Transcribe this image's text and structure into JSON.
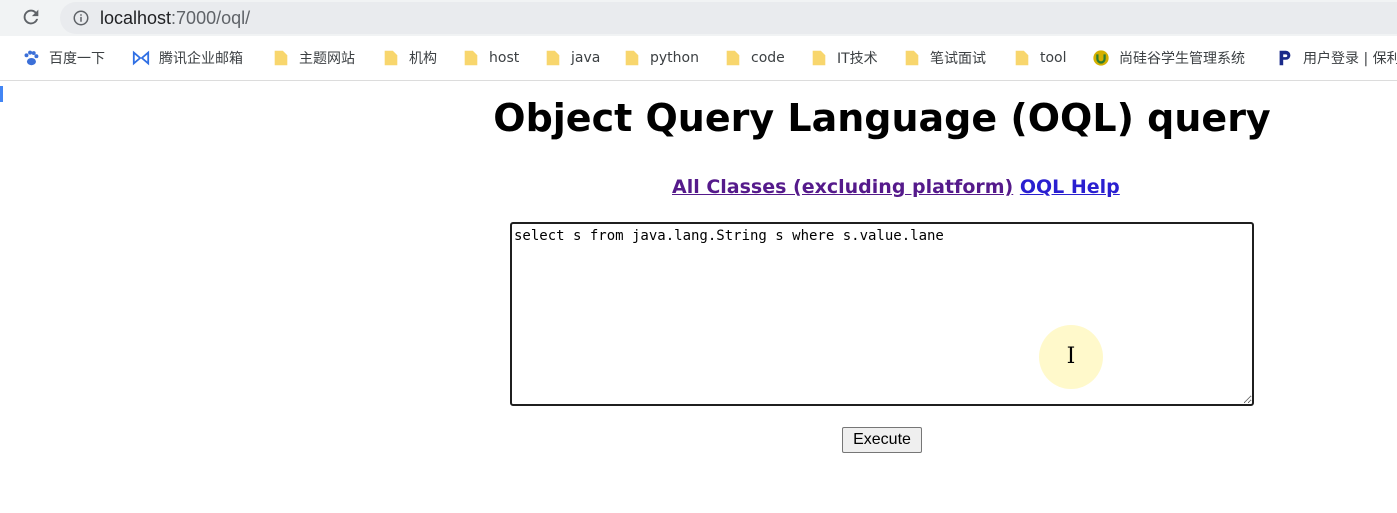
{
  "browser": {
    "url_host": "localhost",
    "url_path": ":7000/oql/"
  },
  "bookmarks": [
    {
      "label": "百度一下",
      "icon": "baidu-paw-icon"
    },
    {
      "label": "腾讯企业邮箱",
      "icon": "tencent-mail-icon"
    },
    {
      "label": "主题网站",
      "icon": "folder-icon"
    },
    {
      "label": "机构",
      "icon": "folder-icon"
    },
    {
      "label": "host",
      "icon": "folder-icon"
    },
    {
      "label": "java",
      "icon": "folder-icon"
    },
    {
      "label": "python",
      "icon": "folder-icon"
    },
    {
      "label": "code",
      "icon": "folder-icon"
    },
    {
      "label": "IT技术",
      "icon": "folder-icon"
    },
    {
      "label": "笔试面试",
      "icon": "folder-icon"
    },
    {
      "label": "tool",
      "icon": "folder-icon"
    },
    {
      "label": "尚硅谷学生管理系统",
      "icon": "atguigu-icon"
    },
    {
      "label": "用户登录 | 保利",
      "icon": "p-logo-icon"
    }
  ],
  "page": {
    "title": "Object Query Language (OQL) query",
    "link_all_classes": "All Classes (excluding platform)",
    "link_oql_help": "OQL Help",
    "query_text": "select s from java.lang.String s where s.value.lane",
    "execute_label": "Execute"
  },
  "colors": {
    "visited_link": "#551a8b",
    "link": "#2a1fd0",
    "folder": "#f8d66d"
  }
}
